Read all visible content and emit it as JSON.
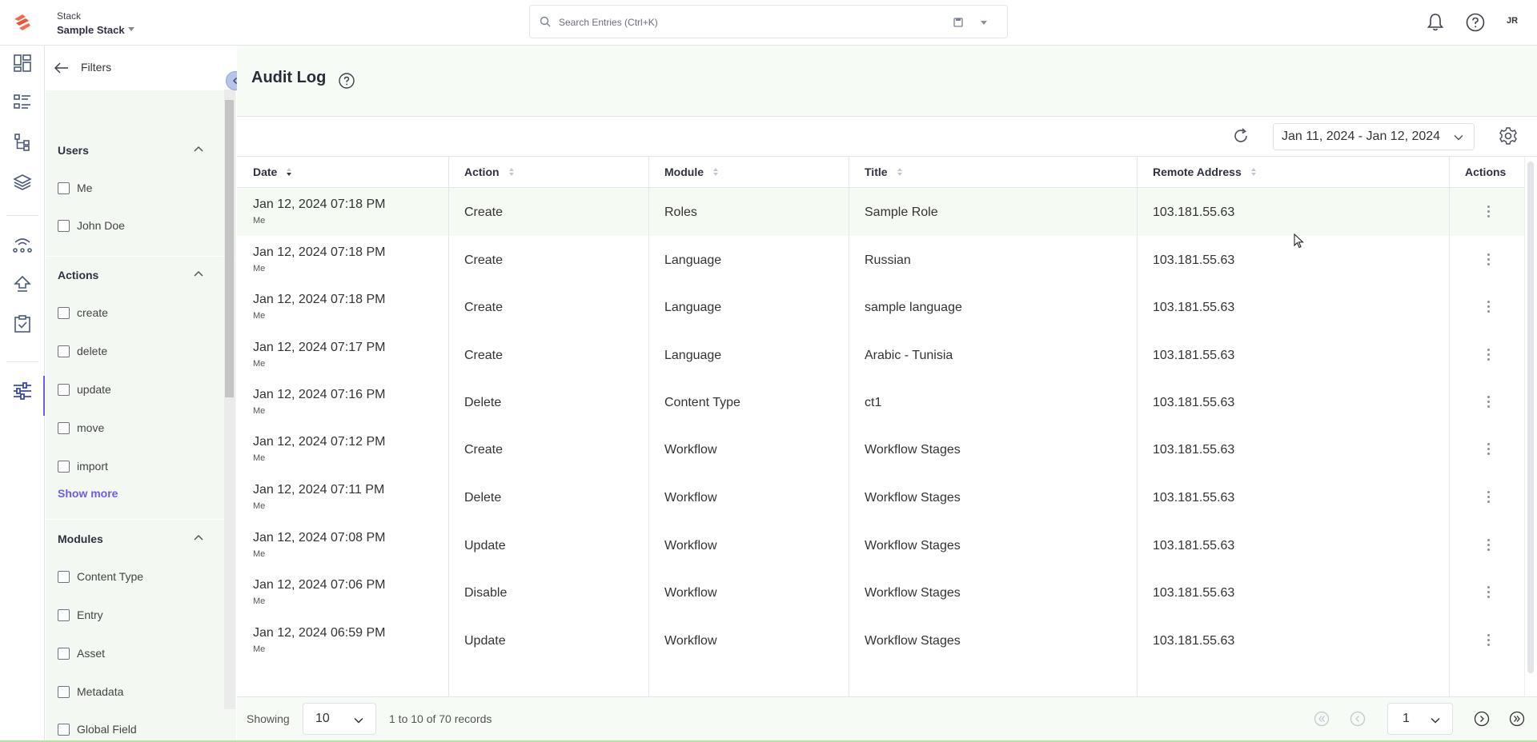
{
  "header": {
    "stack_label": "Stack",
    "stack_name": "Sample Stack",
    "search_placeholder": "Search Entries (Ctrl+K)",
    "avatar_initials": "JR"
  },
  "rail": {
    "icons": [
      "dashboard-icon",
      "entries-list-icon",
      "content-models-icon",
      "assets-layers-icon",
      "releases-icon",
      "deploy-icon",
      "tasks-icon",
      "settings-sliders-icon"
    ],
    "active": "settings-sliders-icon"
  },
  "filters": {
    "title": "Filters",
    "sections": [
      {
        "title": "Users",
        "items": [
          "Me",
          "John Doe"
        ]
      },
      {
        "title": "Actions",
        "items": [
          "create",
          "delete",
          "update",
          "move",
          "import"
        ],
        "show_more": "Show more"
      },
      {
        "title": "Modules",
        "items": [
          "Content Type",
          "Entry",
          "Asset",
          "Metadata",
          "Global Field"
        ]
      }
    ]
  },
  "main": {
    "title": "Audit Log",
    "date_range": "Jan 11, 2024 - Jan 12, 2024"
  },
  "table": {
    "columns": [
      "Date",
      "Action",
      "Module",
      "Title",
      "Remote Address",
      "Actions"
    ],
    "rows": [
      {
        "date": "Jan 12, 2024 07:18 PM",
        "user": "Me",
        "action": "Create",
        "module": "Roles",
        "title": "Sample Role",
        "remote": "103.181.55.63"
      },
      {
        "date": "Jan 12, 2024 07:18 PM",
        "user": "Me",
        "action": "Create",
        "module": "Language",
        "title": "Russian",
        "remote": "103.181.55.63"
      },
      {
        "date": "Jan 12, 2024 07:18 PM",
        "user": "Me",
        "action": "Create",
        "module": "Language",
        "title": "sample language",
        "remote": "103.181.55.63"
      },
      {
        "date": "Jan 12, 2024 07:17 PM",
        "user": "Me",
        "action": "Create",
        "module": "Language",
        "title": "Arabic - Tunisia",
        "remote": "103.181.55.63"
      },
      {
        "date": "Jan 12, 2024 07:16 PM",
        "user": "Me",
        "action": "Delete",
        "module": "Content Type",
        "title": "ct1",
        "remote": "103.181.55.63"
      },
      {
        "date": "Jan 12, 2024 07:12 PM",
        "user": "Me",
        "action": "Create",
        "module": "Workflow",
        "title": "Workflow Stages",
        "remote": "103.181.55.63"
      },
      {
        "date": "Jan 12, 2024 07:11 PM",
        "user": "Me",
        "action": "Delete",
        "module": "Workflow",
        "title": "Workflow Stages",
        "remote": "103.181.55.63"
      },
      {
        "date": "Jan 12, 2024 07:08 PM",
        "user": "Me",
        "action": "Update",
        "module": "Workflow",
        "title": "Workflow Stages",
        "remote": "103.181.55.63"
      },
      {
        "date": "Jan 12, 2024 07:06 PM",
        "user": "Me",
        "action": "Disable",
        "module": "Workflow",
        "title": "Workflow Stages",
        "remote": "103.181.55.63"
      },
      {
        "date": "Jan 12, 2024 06:59 PM",
        "user": "Me",
        "action": "Update",
        "module": "Workflow",
        "title": "Workflow Stages",
        "remote": "103.181.55.63"
      }
    ]
  },
  "footer": {
    "showing_label": "Showing",
    "page_size": "10",
    "records_text": "1 to 10 of 70 records",
    "current_page": "1"
  },
  "colors": {
    "accent": "#6c5ce7",
    "row_highlight": "#f5faf3",
    "border": "#e3e6ee"
  }
}
